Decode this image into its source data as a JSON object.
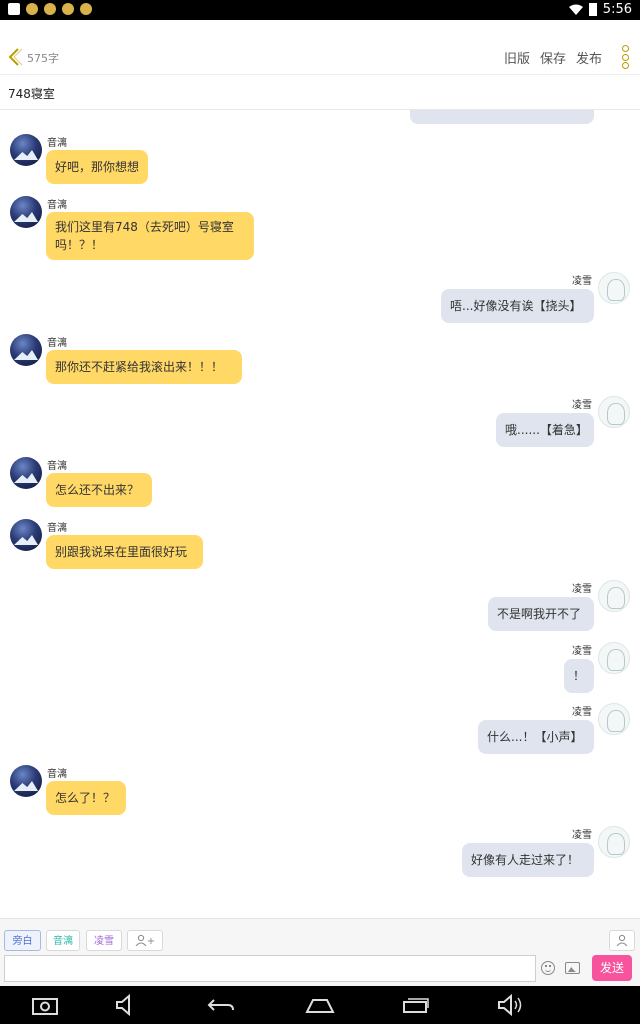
{
  "status_bar": {
    "time": "5:56"
  },
  "header": {
    "word_count": "575字",
    "buttons": [
      "旧版",
      "保存",
      "发布"
    ]
  },
  "title": "748寝室",
  "characters": {
    "left": "音漓",
    "right": "凌雪"
  },
  "messages": [
    {
      "side": "left",
      "name": "音漓",
      "text": "好吧，那你想想"
    },
    {
      "side": "left",
      "name": "音漓",
      "text": "我们这里有748（去死吧）号寝室",
      "text2": "吗！？！"
    },
    {
      "side": "right",
      "name": "凌雪",
      "text": "唔...好像没有诶【挠头】"
    },
    {
      "side": "left",
      "name": "音漓",
      "text": "那你还不赶紧给我滚出来！！！"
    },
    {
      "side": "right",
      "name": "凌雪",
      "text": "哦......【着急】"
    },
    {
      "side": "left",
      "name": "音漓",
      "text": "怎么还不出来？"
    },
    {
      "side": "left",
      "name": "音漓",
      "text": "别跟我说呆在里面很好玩"
    },
    {
      "side": "right",
      "name": "凌雪",
      "text": "不是啊我开不了"
    },
    {
      "side": "right",
      "name": "凌雪",
      "text": "！"
    },
    {
      "side": "right",
      "name": "凌雪",
      "text": "什么...！【小声】"
    },
    {
      "side": "left",
      "name": "音漓",
      "text": "怎么了！？"
    },
    {
      "side": "right",
      "name": "凌雪",
      "text": "好像有人走过来了！"
    }
  ],
  "composer": {
    "roles": [
      "旁白",
      "音漓",
      "凌雪"
    ],
    "add_role_label": "+",
    "input_value": "",
    "send_label": "发送"
  },
  "colors": {
    "left_bubble": "#ffd866",
    "right_bubble": "#dfe4ee",
    "send_button": "#f6559d"
  },
  "icons": [
    "back-chevron-icon",
    "more-icon",
    "emoji-icon",
    "image-icon",
    "add-person-icon",
    "person-icon",
    "camera-icon",
    "volume-down-icon",
    "back-icon",
    "home-icon",
    "recents-icon",
    "volume-up-icon"
  ]
}
